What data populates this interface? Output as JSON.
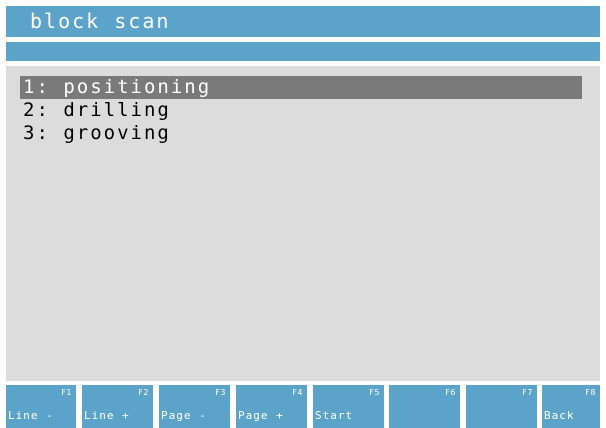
{
  "window": {
    "title": "block scan"
  },
  "list": {
    "items": [
      {
        "label": "1: positioning",
        "selected": true
      },
      {
        "label": "2: drilling",
        "selected": false
      },
      {
        "label": "3: grooving",
        "selected": false
      }
    ]
  },
  "softkeys": [
    {
      "key": "F1",
      "label": "Line -"
    },
    {
      "key": "F2",
      "label": "Line +"
    },
    {
      "key": "F3",
      "label": "Page -"
    },
    {
      "key": "F4",
      "label": "Page +"
    },
    {
      "key": "F5",
      "label": "Start"
    },
    {
      "key": "F6",
      "label": ""
    },
    {
      "key": "F7",
      "label": ""
    },
    {
      "key": "F8",
      "label": "Back"
    }
  ],
  "colors": {
    "bar_blue": "#5ba3c9",
    "content_gray": "#dcdcdc",
    "selection_gray": "#7a7a7a"
  }
}
